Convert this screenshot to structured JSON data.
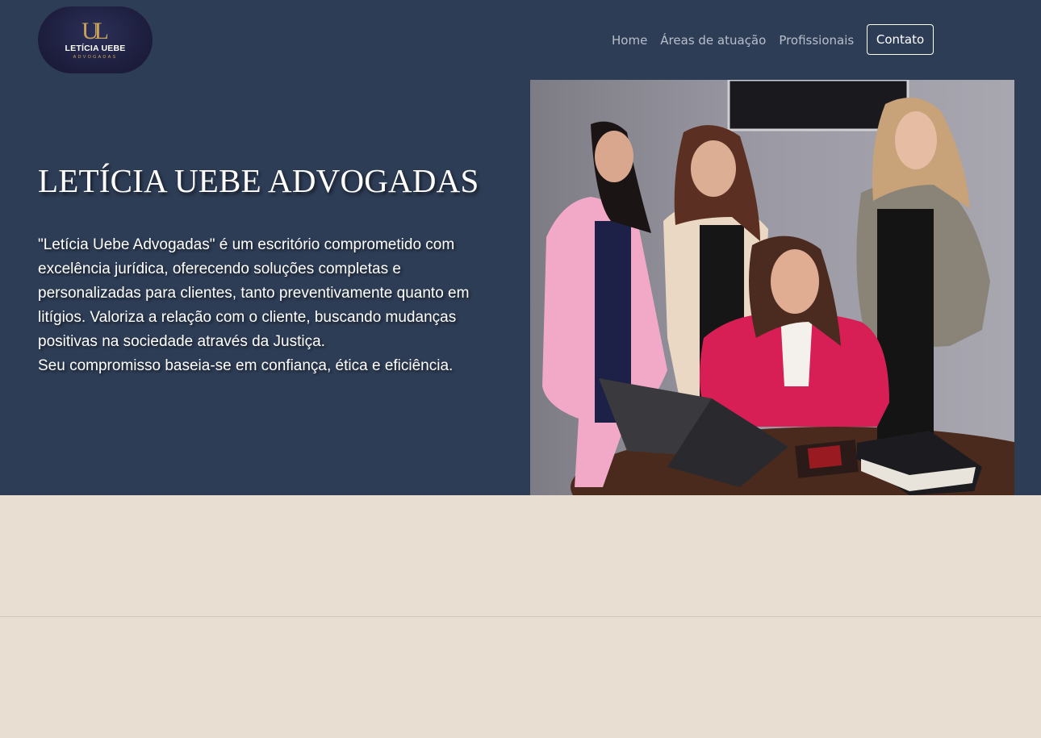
{
  "header": {
    "logo": {
      "mark": "UL",
      "name": "LETÍCIA UEBE",
      "sub": "ADVOGADAS"
    },
    "nav": [
      {
        "label": "Home"
      },
      {
        "label": "Áreas de atuação"
      },
      {
        "label": "Profissionais"
      }
    ],
    "contact_label": "Contato"
  },
  "hero": {
    "title": "LETÍCIA UEBE ADVOGADAS",
    "description_1": "\"Letícia Uebe Advogadas\" é um escritório comprometido com excelência jurídica, oferecendo soluções completas e personalizadas para clientes, tanto preventivamente quanto em litígios. Valoriza a relação com o cliente, buscando mudanças positivas na sociedade através da Justiça.",
    "description_2": "Seu compromisso baseia-se em confiança, ética e eficiência."
  },
  "colors": {
    "hero_bg": "#2e3d56",
    "page_bg": "#e8dfd2",
    "logo_gold": "#c9a35c",
    "pink_blazer": "#f2a9c8",
    "red_blazer": "#d81f55"
  }
}
